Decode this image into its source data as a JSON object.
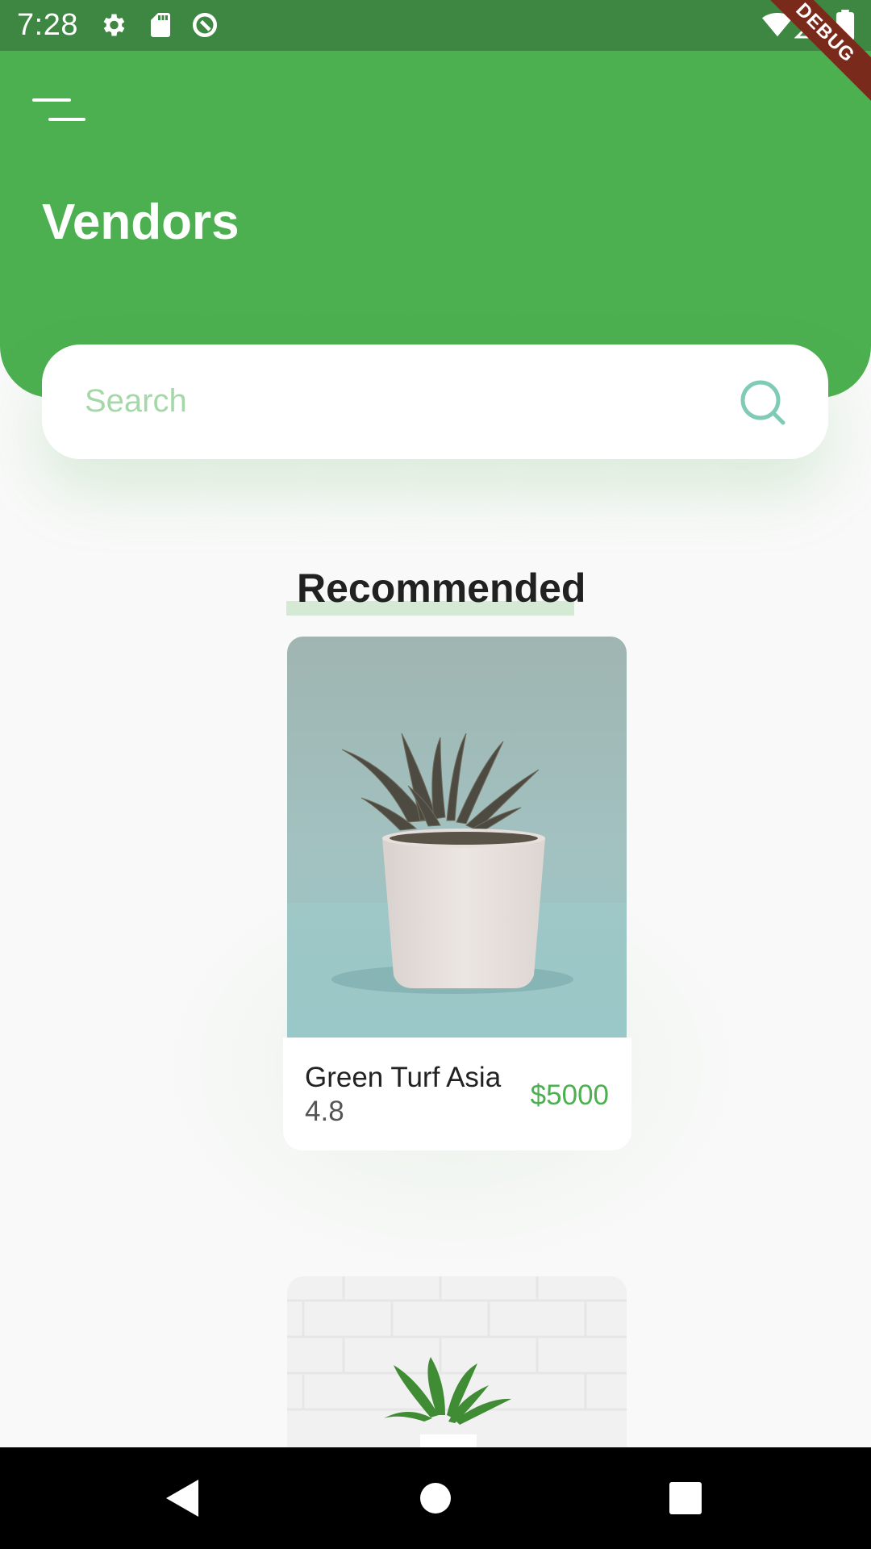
{
  "status_bar": {
    "time": "7:28",
    "icons": [
      "gear-icon",
      "sd-card-icon",
      "data-saver-icon",
      "wifi-icon",
      "signal-icon",
      "battery-icon"
    ],
    "debug_label": "DEBUG"
  },
  "header": {
    "title": "Vendors",
    "menu_icon": "menu-icon",
    "color": "#4caf50"
  },
  "search": {
    "placeholder": "Search",
    "value": "",
    "icon": "search-icon"
  },
  "section": {
    "title": "Recommended"
  },
  "vendors": [
    {
      "name": "Green Turf Asia",
      "rating": "4.8",
      "price": "$5000"
    },
    {
      "name": "",
      "rating": "",
      "price": ""
    }
  ],
  "nav": {
    "buttons": [
      "back-icon",
      "home-icon",
      "recents-icon"
    ]
  },
  "colors": {
    "accent": "#4caf50",
    "status_bar": "#3e8742",
    "price": "#4caf50",
    "search_icon": "#7fcbb6"
  }
}
